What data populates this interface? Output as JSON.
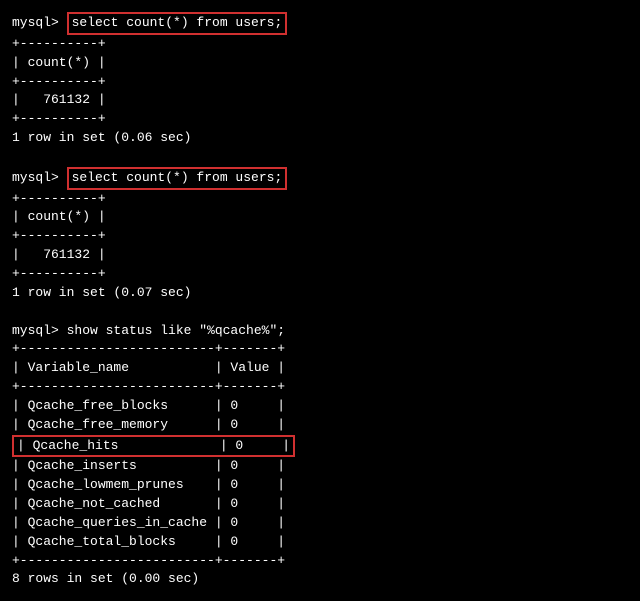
{
  "prompt": "mysql> ",
  "query1": {
    "command": "select count(*) from users;",
    "div_short": "+----------+",
    "header": "| count(*) |",
    "value": "|   761132 |",
    "footer": "1 row in set (0.06 sec)"
  },
  "query2": {
    "command": "select count(*) from users;",
    "div_short": "+----------+",
    "header": "| count(*) |",
    "value": "|   761132 |",
    "footer": "1 row in set (0.07 sec)"
  },
  "query3": {
    "command": "show status like \"%qcache%\";",
    "div_long": "+-------------------------+-------+",
    "header": "| Variable_name           | Value |",
    "rows": [
      "| Qcache_free_blocks      | 0     |",
      "| Qcache_free_memory      | 0     |",
      "| Qcache_hits             | 0     |",
      "| Qcache_inserts          | 0     |",
      "| Qcache_lowmem_prunes    | 0     |",
      "| Qcache_not_cached       | 0     |",
      "| Qcache_queries_in_cache | 0     |",
      "| Qcache_total_blocks     | 0     |"
    ],
    "footer": "8 rows in set (0.00 sec)"
  }
}
